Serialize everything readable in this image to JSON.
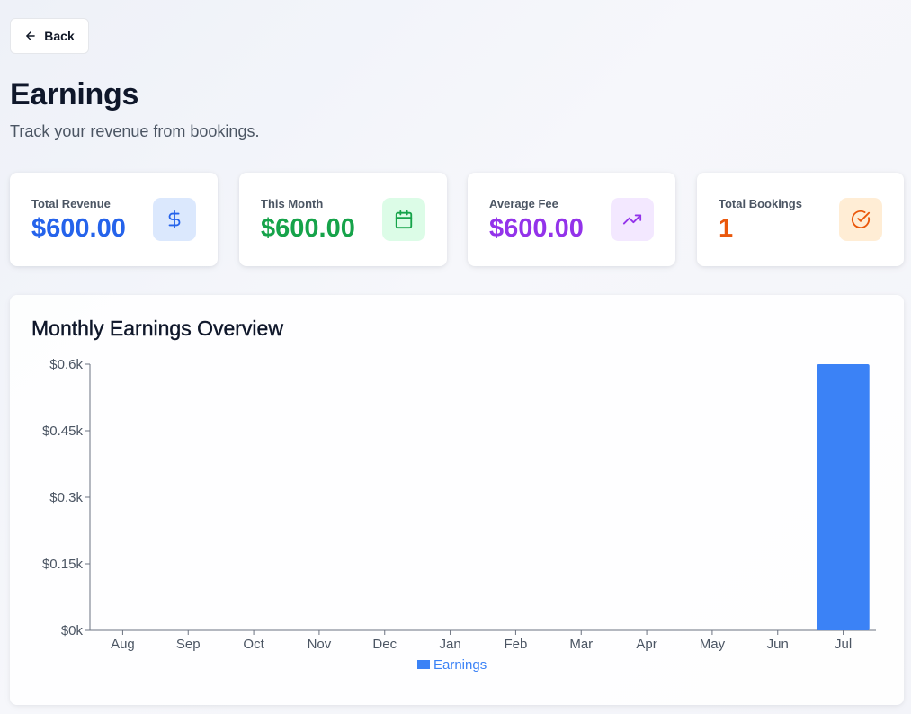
{
  "back": {
    "label": "Back",
    "icon": "arrow-left-icon"
  },
  "header": {
    "title": "Earnings",
    "subtitle": "Track your revenue from bookings."
  },
  "stats": [
    {
      "label": "Total Revenue",
      "value": "$600.00",
      "color": "#2563eb",
      "icon": "dollar-icon",
      "icon_bg": "#dbe8fd",
      "icon_color": "#2563eb"
    },
    {
      "label": "This Month",
      "value": "$600.00",
      "color": "#16a34a",
      "icon": "calendar-icon",
      "icon_bg": "#dcfce7",
      "icon_color": "#16a34a"
    },
    {
      "label": "Average Fee",
      "value": "$600.00",
      "color": "#9333ea",
      "icon": "trending-up-icon",
      "icon_bg": "#f3e8ff",
      "icon_color": "#9333ea"
    },
    {
      "label": "Total Bookings",
      "value": "1",
      "color": "#ea580c",
      "icon": "check-circle-icon",
      "icon_bg": "#ffedd5",
      "icon_color": "#ea580c"
    }
  ],
  "chart_section": {
    "title": "Monthly Earnings Overview"
  },
  "chart_data": {
    "type": "bar",
    "categories": [
      "Aug",
      "Sep",
      "Oct",
      "Nov",
      "Dec",
      "Jan",
      "Feb",
      "Mar",
      "Apr",
      "May",
      "Jun",
      "Jul"
    ],
    "series": [
      {
        "name": "Earnings",
        "values": [
          0,
          0,
          0,
          0,
          0,
          0,
          0,
          0,
          0,
          0,
          0,
          600
        ],
        "color": "#3b82f6"
      }
    ],
    "y_ticks": [
      "$0k",
      "$0.15k",
      "$0.3k",
      "$0.45k",
      "$0.6k"
    ],
    "y_tick_values": [
      0,
      150,
      300,
      450,
      600
    ],
    "ylim": [
      0,
      600
    ],
    "title": "",
    "xlabel": "",
    "ylabel": "",
    "grid": false,
    "legend": "bottom-center"
  }
}
